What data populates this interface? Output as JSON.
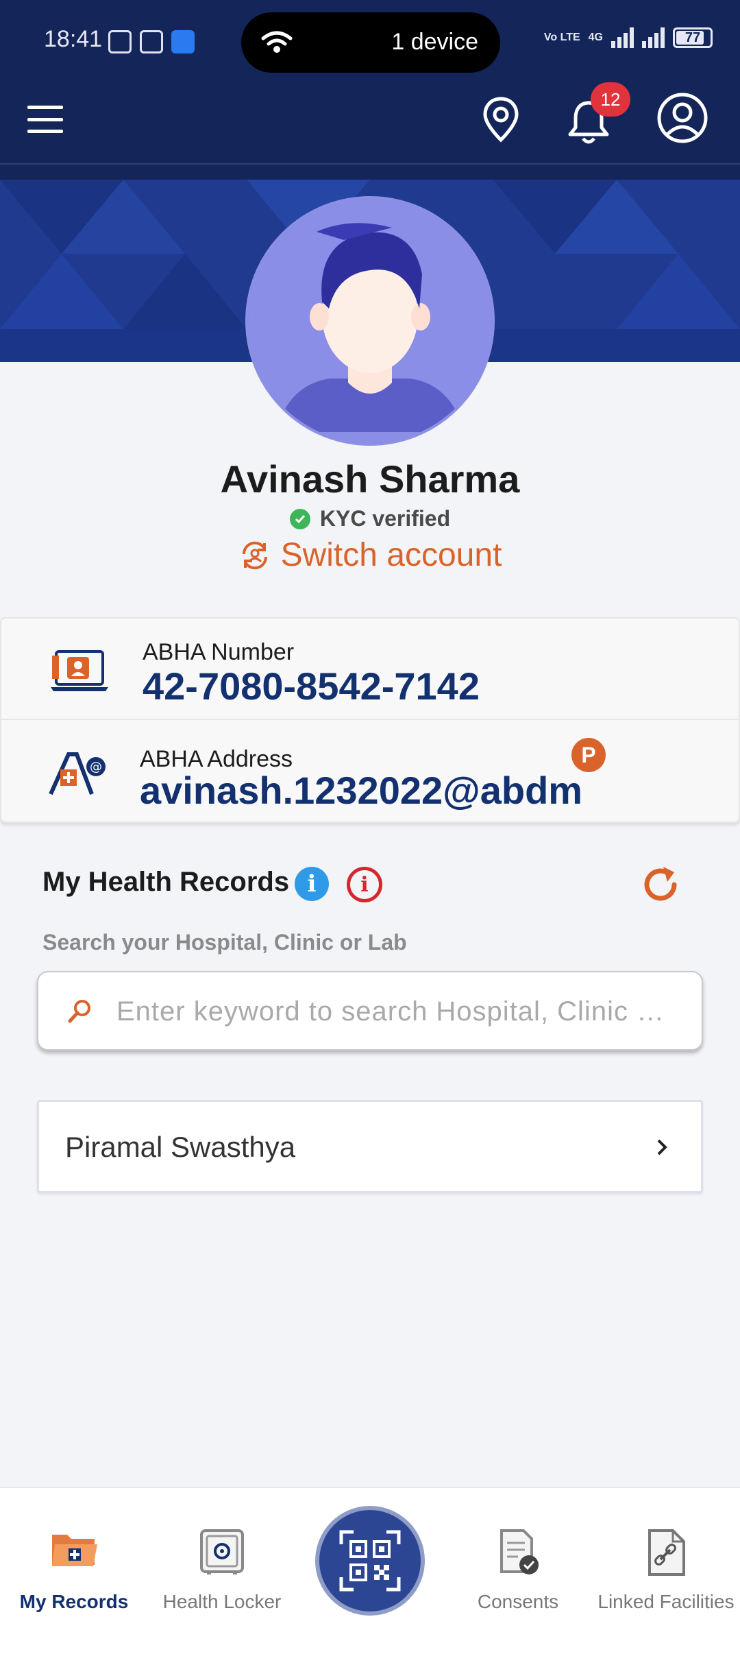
{
  "status_bar": {
    "time": "18:41",
    "hotspot_text": "1 device",
    "network_label_1": "Vo LTE",
    "network_label_2": "4G",
    "battery": "77"
  },
  "app_bar": {
    "notification_count": "12"
  },
  "profile": {
    "name": "Avinash Sharma",
    "kyc_status": "KYC verified",
    "switch_account": "Switch account"
  },
  "abha": {
    "number_label": "ABHA Number",
    "number_value": "42-7080-8542-7142",
    "address_label": "ABHA Address",
    "address_value": "avinash.1232022@abdm",
    "address_badge": "P"
  },
  "records": {
    "title": "My Health Records",
    "info_glyph": "i",
    "alert_glyph": "i",
    "search_caption": "Search your Hospital, Clinic or Lab",
    "search_placeholder": "Enter keyword to search Hospital, Clinic …",
    "facilities": [
      "Piramal Swasthya"
    ]
  },
  "bottom_nav": {
    "items": [
      {
        "label": "My Records",
        "icon": "folder-plus-icon",
        "active": true
      },
      {
        "label": "Health Locker",
        "icon": "safe-locker-icon",
        "active": false
      },
      {
        "label": "",
        "icon": "qr-scan-icon",
        "active": false
      },
      {
        "label": "Consents",
        "icon": "consent-document-icon",
        "active": false
      },
      {
        "label": "Linked Facilities",
        "icon": "linked-document-icon",
        "active": false
      }
    ]
  },
  "colors": {
    "primary_navy": "#142659",
    "accent_orange": "#d9632a",
    "verified_green": "#3fb55a",
    "badge_red": "#e2333d"
  }
}
